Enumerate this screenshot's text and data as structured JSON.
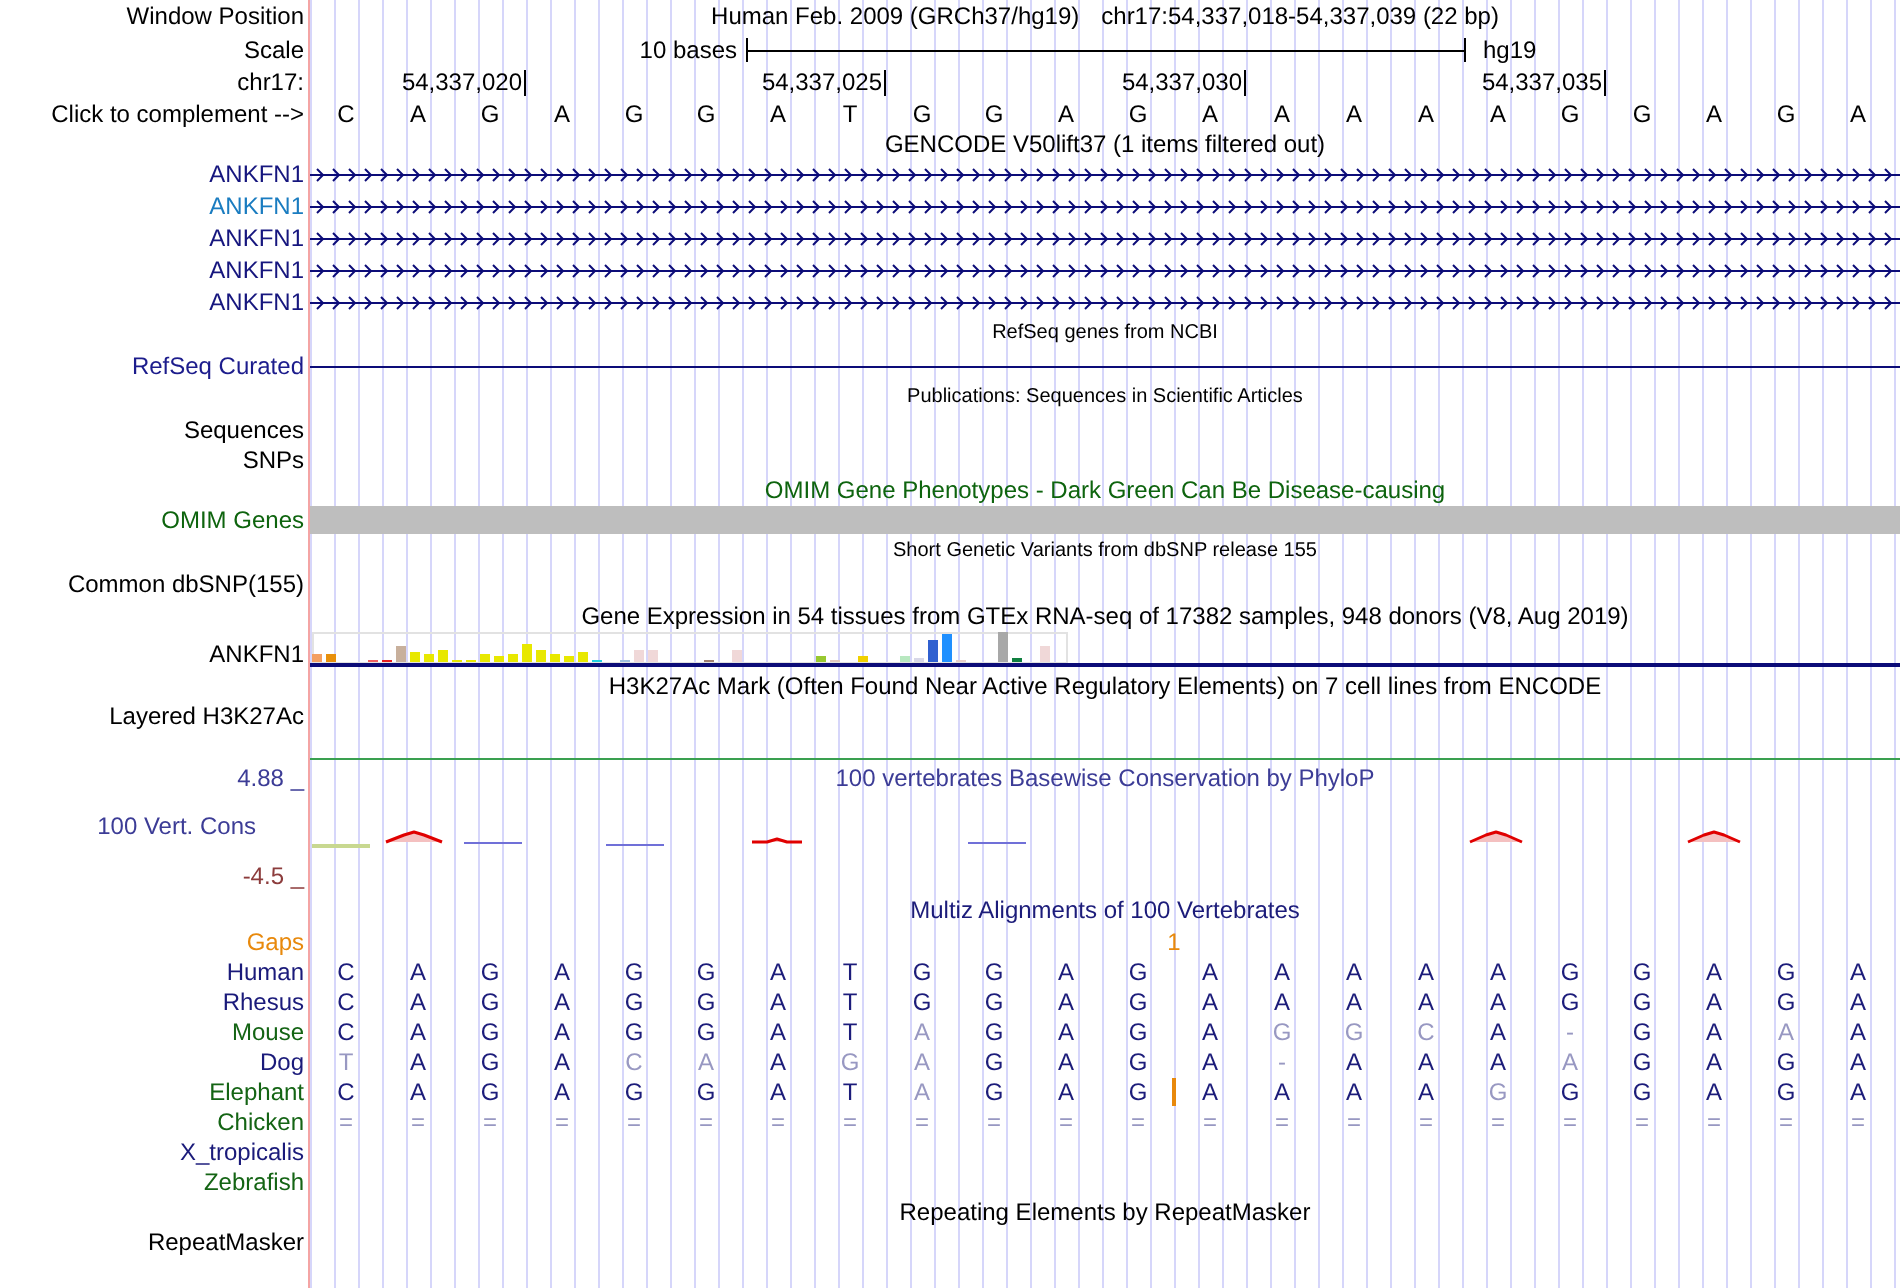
{
  "position": {
    "label": "Window Position",
    "assembly": "Human Feb. 2009 (GRCh37/hg19)",
    "range": "chr17:54,337,018-54,337,039 (22 bp)"
  },
  "scale": {
    "label": "Scale",
    "span": "10 bases",
    "assembly": "hg19"
  },
  "ruler": {
    "label": "chr17:",
    "cells": [
      {
        "kind": "blank"
      },
      {
        "kind": "blank"
      },
      {
        "kind": "tick",
        "text": "54,337,020"
      },
      {
        "kind": "blank"
      },
      {
        "kind": "blank"
      },
      {
        "kind": "blank"
      },
      {
        "kind": "blank"
      },
      {
        "kind": "tick",
        "text": "54,337,025"
      },
      {
        "kind": "blank"
      },
      {
        "kind": "blank"
      },
      {
        "kind": "blank"
      },
      {
        "kind": "blank"
      },
      {
        "kind": "tick",
        "text": "54,337,030"
      },
      {
        "kind": "blank"
      },
      {
        "kind": "blank"
      },
      {
        "kind": "blank"
      },
      {
        "kind": "blank"
      },
      {
        "kind": "tick",
        "text": "54,337,035"
      },
      {
        "kind": "blank"
      },
      {
        "kind": "blank"
      },
      {
        "kind": "blank"
      },
      {
        "kind": "blank"
      }
    ]
  },
  "sequence": {
    "label": "Click to complement -->",
    "bases": [
      "C",
      "A",
      "G",
      "A",
      "G",
      "G",
      "A",
      "T",
      "G",
      "G",
      "A",
      "G",
      "A",
      "A",
      "A",
      "A",
      "A",
      "G",
      "G",
      "A",
      "G",
      "A"
    ]
  },
  "tracks": [
    {
      "kind": "gencode",
      "title": "GENCODE V50lift37 (1 items filtered out)",
      "rows": [
        {
          "label": "ANKFN1",
          "color": "#16167e"
        },
        {
          "label": "ANKFN1",
          "color": "#1a7cc0"
        },
        {
          "label": "ANKFN1",
          "color": "#16167e"
        },
        {
          "label": "ANKFN1",
          "color": "#16167e"
        },
        {
          "label": "ANKFN1",
          "color": "#16167e"
        }
      ]
    },
    {
      "kind": "refseq",
      "title": "RefSeq genes from NCBI",
      "label": "RefSeq Curated"
    },
    {
      "kind": "publications",
      "title": "Publications: Sequences in Scientific Articles",
      "labels": [
        "Sequences",
        "SNPs"
      ]
    },
    {
      "kind": "omim",
      "title": "OMIM Gene Phenotypes - Dark Green Can Be Disease-causing",
      "label": "OMIM Genes"
    },
    {
      "kind": "dbsnp",
      "title": "Short Genetic Variants from dbSNP release 155",
      "label": "Common dbSNP(155)"
    },
    {
      "kind": "gtex",
      "title": "Gene Expression in 54 tissues from GTEx RNA-seq of 17382 samples, 948 donors (V8, Aug 2019)",
      "label": "ANKFN1"
    },
    {
      "kind": "h3k27ac",
      "title": "H3K27Ac Mark (Often Found Near Active Regulatory Elements) on 7 cell lines from ENCODE",
      "label": "Layered H3K27Ac"
    },
    {
      "kind": "phylop",
      "title": "100 vertebrates Basewise Conservation by PhyloP",
      "label": "100 Vert. Cons",
      "max": "4.88 _",
      "min": "-4.5 _"
    },
    {
      "kind": "multiz",
      "title": "Multiz Alignments of 100 Vertebrates",
      "gaps": {
        "label": "Gaps",
        "cells": [
          {
            "kind": "blank"
          },
          {
            "kind": "blank"
          },
          {
            "kind": "blank"
          },
          {
            "kind": "blank"
          },
          {
            "kind": "blank"
          },
          {
            "kind": "blank"
          },
          {
            "kind": "blank"
          },
          {
            "kind": "blank"
          },
          {
            "kind": "blank"
          },
          {
            "kind": "blank"
          },
          {
            "kind": "blank"
          },
          {
            "kind": "blank"
          },
          {
            "kind": "count",
            "text": "1"
          },
          {
            "kind": "blank"
          },
          {
            "kind": "blank"
          },
          {
            "kind": "blank"
          },
          {
            "kind": "blank"
          },
          {
            "kind": "blank"
          },
          {
            "kind": "blank"
          },
          {
            "kind": "blank"
          },
          {
            "kind": "blank"
          },
          {
            "kind": "blank"
          },
          {
            "kind": "blank"
          }
        ]
      },
      "species": [
        {
          "name": "Human",
          "color": "#1a1a7a",
          "cells": [
            {
              "kind": "base",
              "text": "C",
              "dim": false
            },
            {
              "kind": "base",
              "text": "A",
              "dim": false
            },
            {
              "kind": "base",
              "text": "G",
              "dim": false
            },
            {
              "kind": "base",
              "text": "A",
              "dim": false
            },
            {
              "kind": "base",
              "text": "G",
              "dim": false
            },
            {
              "kind": "base",
              "text": "G",
              "dim": false
            },
            {
              "kind": "base",
              "text": "A",
              "dim": false
            },
            {
              "kind": "base",
              "text": "T",
              "dim": false
            },
            {
              "kind": "base",
              "text": "G",
              "dim": false
            },
            {
              "kind": "base",
              "text": "G",
              "dim": false
            },
            {
              "kind": "base",
              "text": "A",
              "dim": false
            },
            {
              "kind": "base",
              "text": "G",
              "dim": false
            },
            {
              "kind": "base",
              "text": "A",
              "dim": false
            },
            {
              "kind": "base",
              "text": "A",
              "dim": false
            },
            {
              "kind": "base",
              "text": "A",
              "dim": false
            },
            {
              "kind": "base",
              "text": "A",
              "dim": false
            },
            {
              "kind": "base",
              "text": "A",
              "dim": false
            },
            {
              "kind": "base",
              "text": "G",
              "dim": false
            },
            {
              "kind": "base",
              "text": "G",
              "dim": false
            },
            {
              "kind": "base",
              "text": "A",
              "dim": false
            },
            {
              "kind": "base",
              "text": "G",
              "dim": false
            },
            {
              "kind": "base",
              "text": "A",
              "dim": false
            }
          ]
        },
        {
          "name": "Rhesus",
          "color": "#1a1a7a",
          "cells": [
            {
              "kind": "base",
              "text": "C",
              "dim": false
            },
            {
              "kind": "base",
              "text": "A",
              "dim": false
            },
            {
              "kind": "base",
              "text": "G",
              "dim": false
            },
            {
              "kind": "base",
              "text": "A",
              "dim": false
            },
            {
              "kind": "base",
              "text": "G",
              "dim": false
            },
            {
              "kind": "base",
              "text": "G",
              "dim": false
            },
            {
              "kind": "base",
              "text": "A",
              "dim": false
            },
            {
              "kind": "base",
              "text": "T",
              "dim": false
            },
            {
              "kind": "base",
              "text": "G",
              "dim": false
            },
            {
              "kind": "base",
              "text": "G",
              "dim": false
            },
            {
              "kind": "base",
              "text": "A",
              "dim": false
            },
            {
              "kind": "base",
              "text": "G",
              "dim": false
            },
            {
              "kind": "base",
              "text": "A",
              "dim": false
            },
            {
              "kind": "base",
              "text": "A",
              "dim": false
            },
            {
              "kind": "base",
              "text": "A",
              "dim": false
            },
            {
              "kind": "base",
              "text": "A",
              "dim": false
            },
            {
              "kind": "base",
              "text": "A",
              "dim": false
            },
            {
              "kind": "base",
              "text": "G",
              "dim": false
            },
            {
              "kind": "base",
              "text": "G",
              "dim": false
            },
            {
              "kind": "base",
              "text": "A",
              "dim": false
            },
            {
              "kind": "base",
              "text": "G",
              "dim": false
            },
            {
              "kind": "base",
              "text": "A",
              "dim": false
            }
          ]
        },
        {
          "name": "Mouse",
          "color": "#146414",
          "cells": [
            {
              "kind": "base",
              "text": "C",
              "dim": false
            },
            {
              "kind": "base",
              "text": "A",
              "dim": false
            },
            {
              "kind": "base",
              "text": "G",
              "dim": false
            },
            {
              "kind": "base",
              "text": "A",
              "dim": false
            },
            {
              "kind": "base",
              "text": "G",
              "dim": false
            },
            {
              "kind": "base",
              "text": "G",
              "dim": false
            },
            {
              "kind": "base",
              "text": "A",
              "dim": false
            },
            {
              "kind": "base",
              "text": "T",
              "dim": false
            },
            {
              "kind": "base",
              "text": "A",
              "dim": true
            },
            {
              "kind": "base",
              "text": "G",
              "dim": false
            },
            {
              "kind": "base",
              "text": "A",
              "dim": false
            },
            {
              "kind": "base",
              "text": "G",
              "dim": false
            },
            {
              "kind": "base",
              "text": "A",
              "dim": false
            },
            {
              "kind": "base",
              "text": "G",
              "dim": true
            },
            {
              "kind": "base",
              "text": "G",
              "dim": true
            },
            {
              "kind": "base",
              "text": "C",
              "dim": true
            },
            {
              "kind": "base",
              "text": "A",
              "dim": false
            },
            {
              "kind": "base",
              "text": "-",
              "dim": true
            },
            {
              "kind": "base",
              "text": "G",
              "dim": false
            },
            {
              "kind": "base",
              "text": "A",
              "dim": false
            },
            {
              "kind": "base",
              "text": "A",
              "dim": true
            },
            {
              "kind": "base",
              "text": "A",
              "dim": false
            }
          ]
        },
        {
          "name": "Dog",
          "color": "#1a1a7a",
          "cells": [
            {
              "kind": "base",
              "text": "T",
              "dim": true
            },
            {
              "kind": "base",
              "text": "A",
              "dim": false
            },
            {
              "kind": "base",
              "text": "G",
              "dim": false
            },
            {
              "kind": "base",
              "text": "A",
              "dim": false
            },
            {
              "kind": "base",
              "text": "C",
              "dim": true
            },
            {
              "kind": "base",
              "text": "A",
              "dim": true
            },
            {
              "kind": "base",
              "text": "A",
              "dim": false
            },
            {
              "kind": "base",
              "text": "G",
              "dim": true
            },
            {
              "kind": "base",
              "text": "A",
              "dim": true
            },
            {
              "kind": "base",
              "text": "G",
              "dim": false
            },
            {
              "kind": "base",
              "text": "A",
              "dim": false
            },
            {
              "kind": "base",
              "text": "G",
              "dim": false
            },
            {
              "kind": "base",
              "text": "A",
              "dim": false
            },
            {
              "kind": "base",
              "text": "-",
              "dim": true
            },
            {
              "kind": "base",
              "text": "A",
              "dim": false
            },
            {
              "kind": "base",
              "text": "A",
              "dim": false
            },
            {
              "kind": "base",
              "text": "A",
              "dim": false
            },
            {
              "kind": "base",
              "text": "A",
              "dim": true
            },
            {
              "kind": "base",
              "text": "G",
              "dim": false
            },
            {
              "kind": "base",
              "text": "A",
              "dim": false
            },
            {
              "kind": "base",
              "text": "G",
              "dim": false
            },
            {
              "kind": "base",
              "text": "A",
              "dim": false
            }
          ]
        },
        {
          "name": "Elephant",
          "color": "#146414",
          "cells": [
            {
              "kind": "base",
              "text": "C",
              "dim": false
            },
            {
              "kind": "base",
              "text": "A",
              "dim": false
            },
            {
              "kind": "base",
              "text": "G",
              "dim": false
            },
            {
              "kind": "base",
              "text": "A",
              "dim": false
            },
            {
              "kind": "base",
              "text": "G",
              "dim": false
            },
            {
              "kind": "base",
              "text": "G",
              "dim": false
            },
            {
              "kind": "base",
              "text": "A",
              "dim": false
            },
            {
              "kind": "base",
              "text": "T",
              "dim": false
            },
            {
              "kind": "base",
              "text": "A",
              "dim": true
            },
            {
              "kind": "base",
              "text": "G",
              "dim": false
            },
            {
              "kind": "base",
              "text": "A",
              "dim": false
            },
            {
              "kind": "base",
              "text": "G",
              "dim": false
            },
            {
              "kind": "insertion"
            },
            {
              "kind": "base",
              "text": "A",
              "dim": false
            },
            {
              "kind": "base",
              "text": "A",
              "dim": false
            },
            {
              "kind": "base",
              "text": "A",
              "dim": false
            },
            {
              "kind": "base",
              "text": "A",
              "dim": false
            },
            {
              "kind": "base",
              "text": "G",
              "dim": true
            },
            {
              "kind": "base",
              "text": "G",
              "dim": false
            },
            {
              "kind": "base",
              "text": "G",
              "dim": false
            },
            {
              "kind": "base",
              "text": "A",
              "dim": false
            },
            {
              "kind": "base",
              "text": "G",
              "dim": false
            },
            {
              "kind": "base",
              "text": "A",
              "dim": false
            }
          ]
        },
        {
          "name": "Chicken",
          "color": "#146414",
          "cells": [
            {
              "kind": "base",
              "text": "=",
              "dim": true
            },
            {
              "kind": "base",
              "text": "=",
              "dim": true
            },
            {
              "kind": "base",
              "text": "=",
              "dim": true
            },
            {
              "kind": "base",
              "text": "=",
              "dim": true
            },
            {
              "kind": "base",
              "text": "=",
              "dim": true
            },
            {
              "kind": "base",
              "text": "=",
              "dim": true
            },
            {
              "kind": "base",
              "text": "=",
              "dim": true
            },
            {
              "kind": "base",
              "text": "=",
              "dim": true
            },
            {
              "kind": "base",
              "text": "=",
              "dim": true
            },
            {
              "kind": "base",
              "text": "=",
              "dim": true
            },
            {
              "kind": "base",
              "text": "=",
              "dim": true
            },
            {
              "kind": "base",
              "text": "=",
              "dim": true
            },
            {
              "kind": "base",
              "text": "=",
              "dim": true
            },
            {
              "kind": "base",
              "text": "=",
              "dim": true
            },
            {
              "kind": "base",
              "text": "=",
              "dim": true
            },
            {
              "kind": "base",
              "text": "=",
              "dim": true
            },
            {
              "kind": "base",
              "text": "=",
              "dim": true
            },
            {
              "kind": "base",
              "text": "=",
              "dim": true
            },
            {
              "kind": "base",
              "text": "=",
              "dim": true
            },
            {
              "kind": "base",
              "text": "=",
              "dim": true
            },
            {
              "kind": "base",
              "text": "=",
              "dim": true
            },
            {
              "kind": "base",
              "text": "=",
              "dim": true
            }
          ]
        },
        {
          "name": "X_tropicalis",
          "color": "#1a1a7a"
        },
        {
          "name": "Zebrafish",
          "color": "#146414"
        }
      ]
    },
    {
      "kind": "repeatmasker",
      "title": "Repeating Elements by RepeatMasker",
      "label": "RepeatMasker"
    }
  ]
}
